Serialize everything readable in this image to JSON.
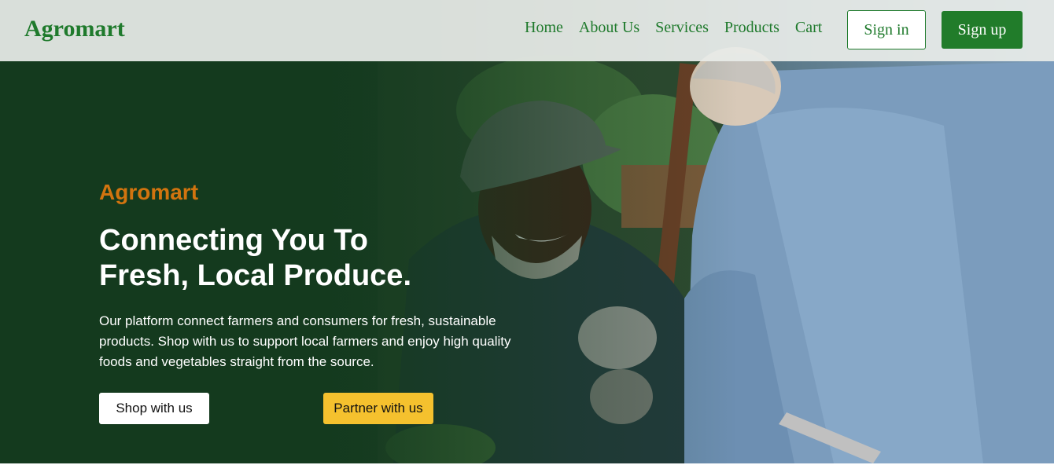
{
  "navbar": {
    "brand": "Agromart",
    "links": [
      "Home",
      "About Us",
      "Services",
      "Products",
      "Cart"
    ],
    "signin_label": "Sign in",
    "signup_label": "Sign up"
  },
  "hero": {
    "eyebrow": "Agromart",
    "headline_line1": "Connecting You To",
    "headline_line2": "Fresh, Local Produce.",
    "description": "Our platform connect farmers and consumers for fresh, sustainable products. Shop with us to support local farmers and enjoy high quality foods and vegetables straight from the source.",
    "shop_label": "Shop with us",
    "partner_label": "Partner with us"
  },
  "colors": {
    "brand_green": "#1f7a2c",
    "hero_dark_green": "#143a1e",
    "accent_orange": "#d2740f",
    "accent_yellow": "#f5c12e"
  }
}
